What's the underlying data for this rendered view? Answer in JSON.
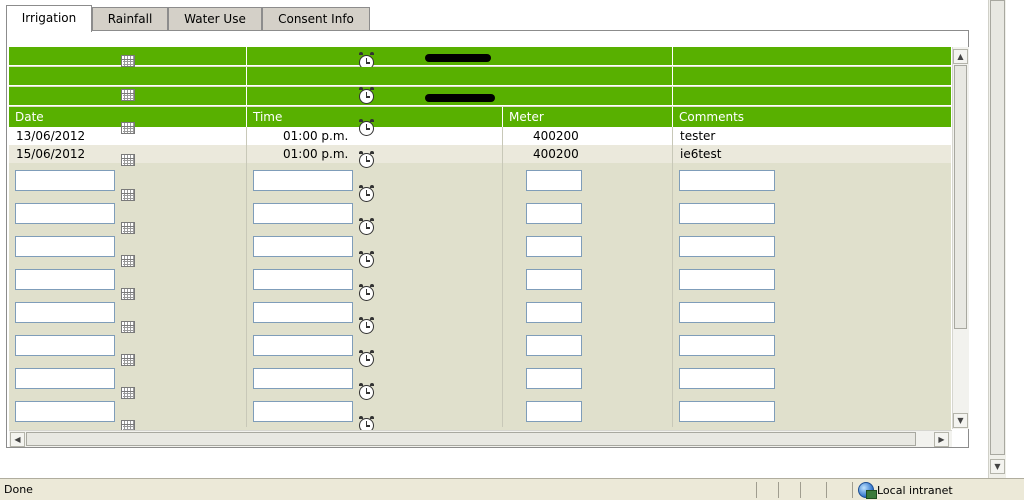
{
  "tabs": [
    {
      "label": "Irrigation",
      "active": true
    },
    {
      "label": "Rainfall",
      "active": false
    },
    {
      "label": "Water Use",
      "active": false
    },
    {
      "label": "Consent Info",
      "active": false
    }
  ],
  "grid": {
    "columns": [
      "Date",
      "Time",
      "Meter",
      "Comments"
    ],
    "rows": [
      {
        "date": "13/06/2012",
        "time": "01:00 p.m.",
        "meter": "400200",
        "comments": "tester"
      },
      {
        "date": "15/06/2012",
        "time": "01:00 p.m.",
        "meter": "400200",
        "comments": "ie6test"
      }
    ],
    "empty_input_rows": 8
  },
  "statusbar": {
    "status": "Done",
    "zone": "Local intranet"
  },
  "colors": {
    "header_green": "#58b000",
    "grid_background": "#e0e0cc",
    "input_border": "#7f9db9"
  },
  "icons": {
    "calendar": "calendar-icon",
    "clock": "clock-icon",
    "zone": "globe-icon"
  }
}
